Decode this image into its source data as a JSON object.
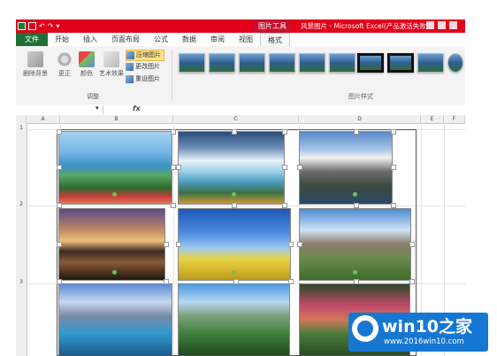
{
  "title_bar": {
    "context_tab": "图片工具",
    "app_title": "风景图片 - Microsoft Excel(产品激活失败)",
    "bg_color": "#e2001a"
  },
  "tabs": [
    {
      "label": "文件",
      "active": false,
      "file": true
    },
    {
      "label": "开始",
      "active": false
    },
    {
      "label": "插入",
      "active": false
    },
    {
      "label": "页面布局",
      "active": false
    },
    {
      "label": "公式",
      "active": false
    },
    {
      "label": "数据",
      "active": false
    },
    {
      "label": "审阅",
      "active": false
    },
    {
      "label": "视图",
      "active": false
    },
    {
      "label": "格式",
      "active": true
    }
  ],
  "ribbon": {
    "remove_bg": "删除背景",
    "corrections": "更正",
    "color": "颜色",
    "artistic": "艺术效果",
    "compress": "压缩图片",
    "change": "更改图片",
    "reset": "重设图片",
    "group_adjust": "调整",
    "group_styles": "图片样式"
  },
  "sheet": {
    "fx_label": "fx",
    "columns": [
      "A",
      "B",
      "C",
      "D",
      "E",
      "F"
    ],
    "rows": [
      "1",
      "2",
      "3"
    ]
  },
  "watermark": {
    "title": "win10之家",
    "url": "www.2016win10.com"
  }
}
